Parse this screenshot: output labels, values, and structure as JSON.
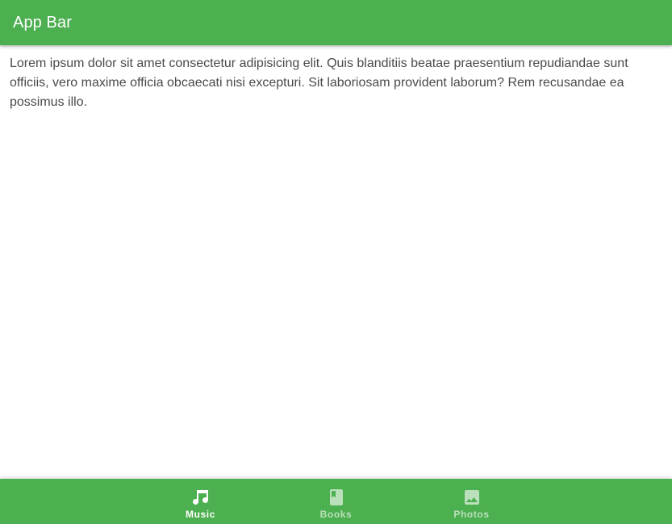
{
  "app_bar": {
    "title": "App Bar"
  },
  "content": {
    "body_text": "Lorem ipsum dolor sit amet consectetur adipisicing elit. Quis blanditiis beatae praesentium repudiandae sunt officiis, vero maxime officia obcaecati nisi excepturi. Sit laboriosam provident laborum? Rem recusandae ea possimus illo."
  },
  "bottom_nav": {
    "items": [
      {
        "label": "Music",
        "icon": "music-note-icon",
        "active": true
      },
      {
        "label": "Books",
        "icon": "book-icon",
        "active": false
      },
      {
        "label": "Photos",
        "icon": "image-icon",
        "active": false
      }
    ]
  },
  "colors": {
    "primary": "#4caf50",
    "on_primary": "#ffffff",
    "body_text": "#4a4a4a"
  }
}
